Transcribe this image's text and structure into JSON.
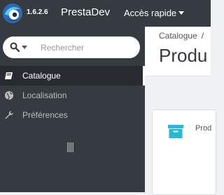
{
  "app": {
    "version": "1.6.2.6",
    "shop_name": "PrestaDev",
    "quick_access_label": "Accès rapide"
  },
  "search": {
    "placeholder": "Rechercher"
  },
  "sidebar": {
    "items": [
      {
        "label": "Catalogue",
        "icon": "book-icon",
        "active": true
      },
      {
        "label": "Localisation",
        "icon": "globe-icon",
        "active": false
      },
      {
        "label": "Préférences",
        "icon": "wrench-icon",
        "active": false
      }
    ]
  },
  "main": {
    "breadcrumb": [
      "Catalogue",
      "/"
    ],
    "page_title": "Produ",
    "panel_text": "Prod"
  },
  "colors": {
    "topbar": "#363a41",
    "sidebar": "#363a41",
    "active_item": "#282b30",
    "accent": "#25b9d7"
  }
}
